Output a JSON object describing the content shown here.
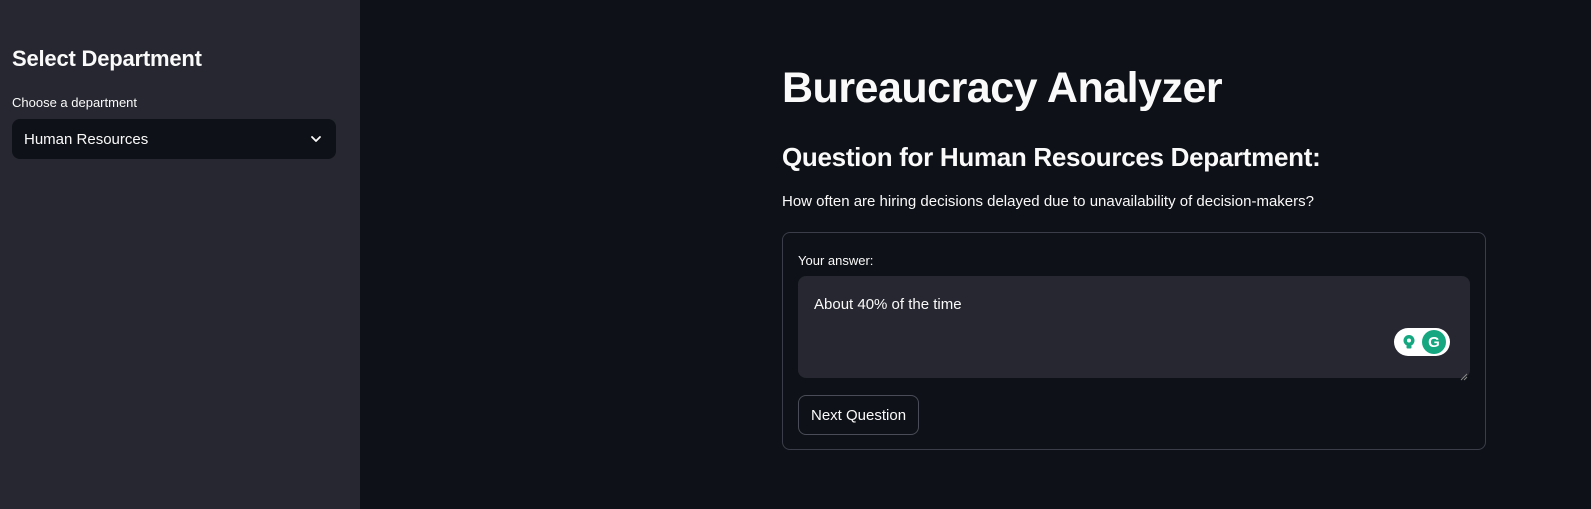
{
  "sidebar": {
    "title": "Select Department",
    "select_label": "Choose a department",
    "selected_value": "Human Resources",
    "chevron_icon": "chevron-down-icon"
  },
  "main": {
    "title": "Bureaucracy Analyzer",
    "question_heading": "Question for Human Resources Department:",
    "question_text": "How often are hiring decisions delayed due to unavailability of decision-makers?",
    "answer_label": "Your answer:",
    "answer_value": "About 40% of the time",
    "grammarly_icons": [
      "lightbulb-icon",
      "grammarly-icon"
    ],
    "grammarly_glyph": "G",
    "next_button_label": "Next Question"
  },
  "colors": {
    "background": "#0e1117",
    "sidebar": "#262730",
    "input_bg": "#262730",
    "text": "#fafafa",
    "grammarly_green": "#15a77f"
  }
}
